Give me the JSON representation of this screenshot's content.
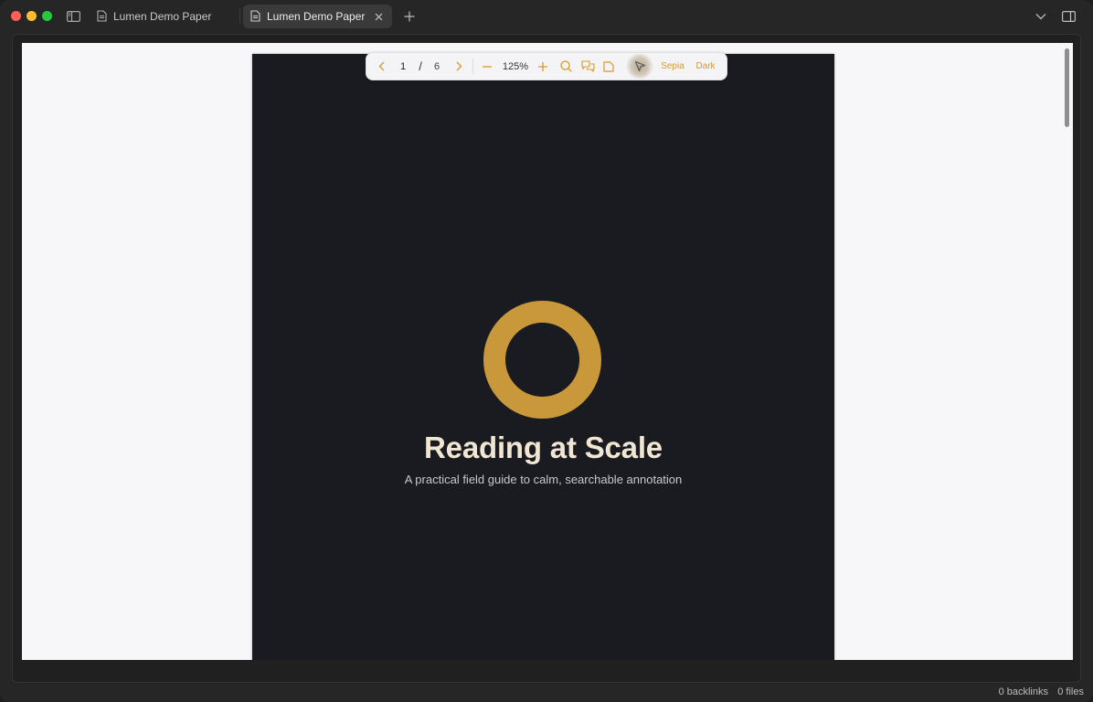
{
  "tabs": [
    {
      "label": "Lumen Demo Paper",
      "icon": "document-icon",
      "active": false
    },
    {
      "label": "Lumen Demo Paper",
      "icon": "document-icon",
      "active": true
    }
  ],
  "toolbar": {
    "current_page": "1",
    "separator": "/",
    "total_pages": "6",
    "zoom": "125%",
    "sepia_label": "Sepia",
    "dark_label": "Dark",
    "accent_color": "#d49a2e"
  },
  "document": {
    "title": "Reading at Scale",
    "subtitle": "A practical field guide to calm, searchable annotation",
    "page_background": "#191b21",
    "ring_color": "#c9983a"
  },
  "status": {
    "backlinks": "0 backlinks",
    "files": "0 files"
  }
}
